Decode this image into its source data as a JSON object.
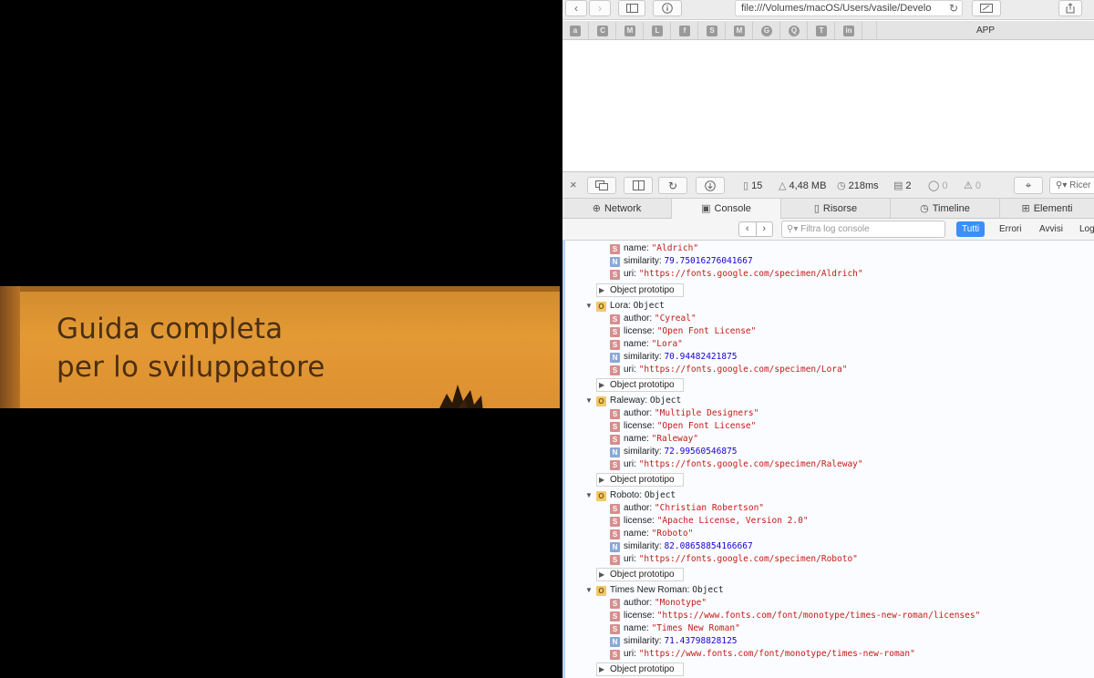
{
  "photo": {
    "title_line1": "Guida completa",
    "title_line2": "per lo sviluppatore"
  },
  "safari": {
    "address": "file:///Volumes/macOS/Users/vasile/Develo",
    "favorites": [
      "a",
      "C",
      "M",
      "L",
      "f",
      "S",
      "M",
      "G",
      "Q",
      "T",
      "in"
    ],
    "tab_title": "APP"
  },
  "inspector": {
    "resources_count": "15",
    "size": "4,48 MB",
    "time": "218ms",
    "logs": "2",
    "errors": "0",
    "warnings": "0",
    "search_placeholder": "Ricer",
    "tabs": {
      "network": "Network",
      "console": "Console",
      "resources": "Risorse",
      "timeline": "Timeline",
      "elements": "Elementi"
    },
    "filter_placeholder": "Filtra log console",
    "filters": {
      "all": "Tutti",
      "errors": "Errori",
      "warnings": "Avvisi",
      "log": "Log"
    }
  },
  "console": {
    "proto_label": "Object prototipo",
    "aldrich_tail": {
      "name": "\"Aldrich\"",
      "similarity": "79.75016276041667",
      "uri": "\"https://fonts.google.com/specimen/Aldrich\""
    },
    "objects": [
      {
        "header": "Lora:",
        "type": "Object",
        "author": "\"Cyreal\"",
        "license": "\"Open Font License\"",
        "name": "\"Lora\"",
        "similarity": "70.94482421875",
        "uri": "\"https://fonts.google.com/specimen/Lora\""
      },
      {
        "header": "Raleway:",
        "type": "Object",
        "author": "\"Multiple Designers\"",
        "license": "\"Open Font License\"",
        "name": "\"Raleway\"",
        "similarity": "72.99560546875",
        "uri": "\"https://fonts.google.com/specimen/Raleway\""
      },
      {
        "header": "Roboto:",
        "type": "Object",
        "author": "\"Christian Robertson\"",
        "license": "\"Apache License, Version 2.0\"",
        "name": "\"Roboto\"",
        "similarity": "82.08658854166667",
        "uri": "\"https://fonts.google.com/specimen/Roboto\""
      },
      {
        "header": "Times New Roman:",
        "type": "Object",
        "author": "\"Monotype\"",
        "license": "\"https://www.fonts.com/font/monotype/times-new-roman/licenses\"",
        "name": "\"Times New Roman\"",
        "similarity": "71.43798828125",
        "uri": "\"https://www.fonts.com/font/monotype/times-new-roman\""
      }
    ],
    "keys": {
      "author": "author:",
      "license": "license:",
      "name": "name:",
      "similarity": "similarity:",
      "uri": "uri:"
    }
  }
}
